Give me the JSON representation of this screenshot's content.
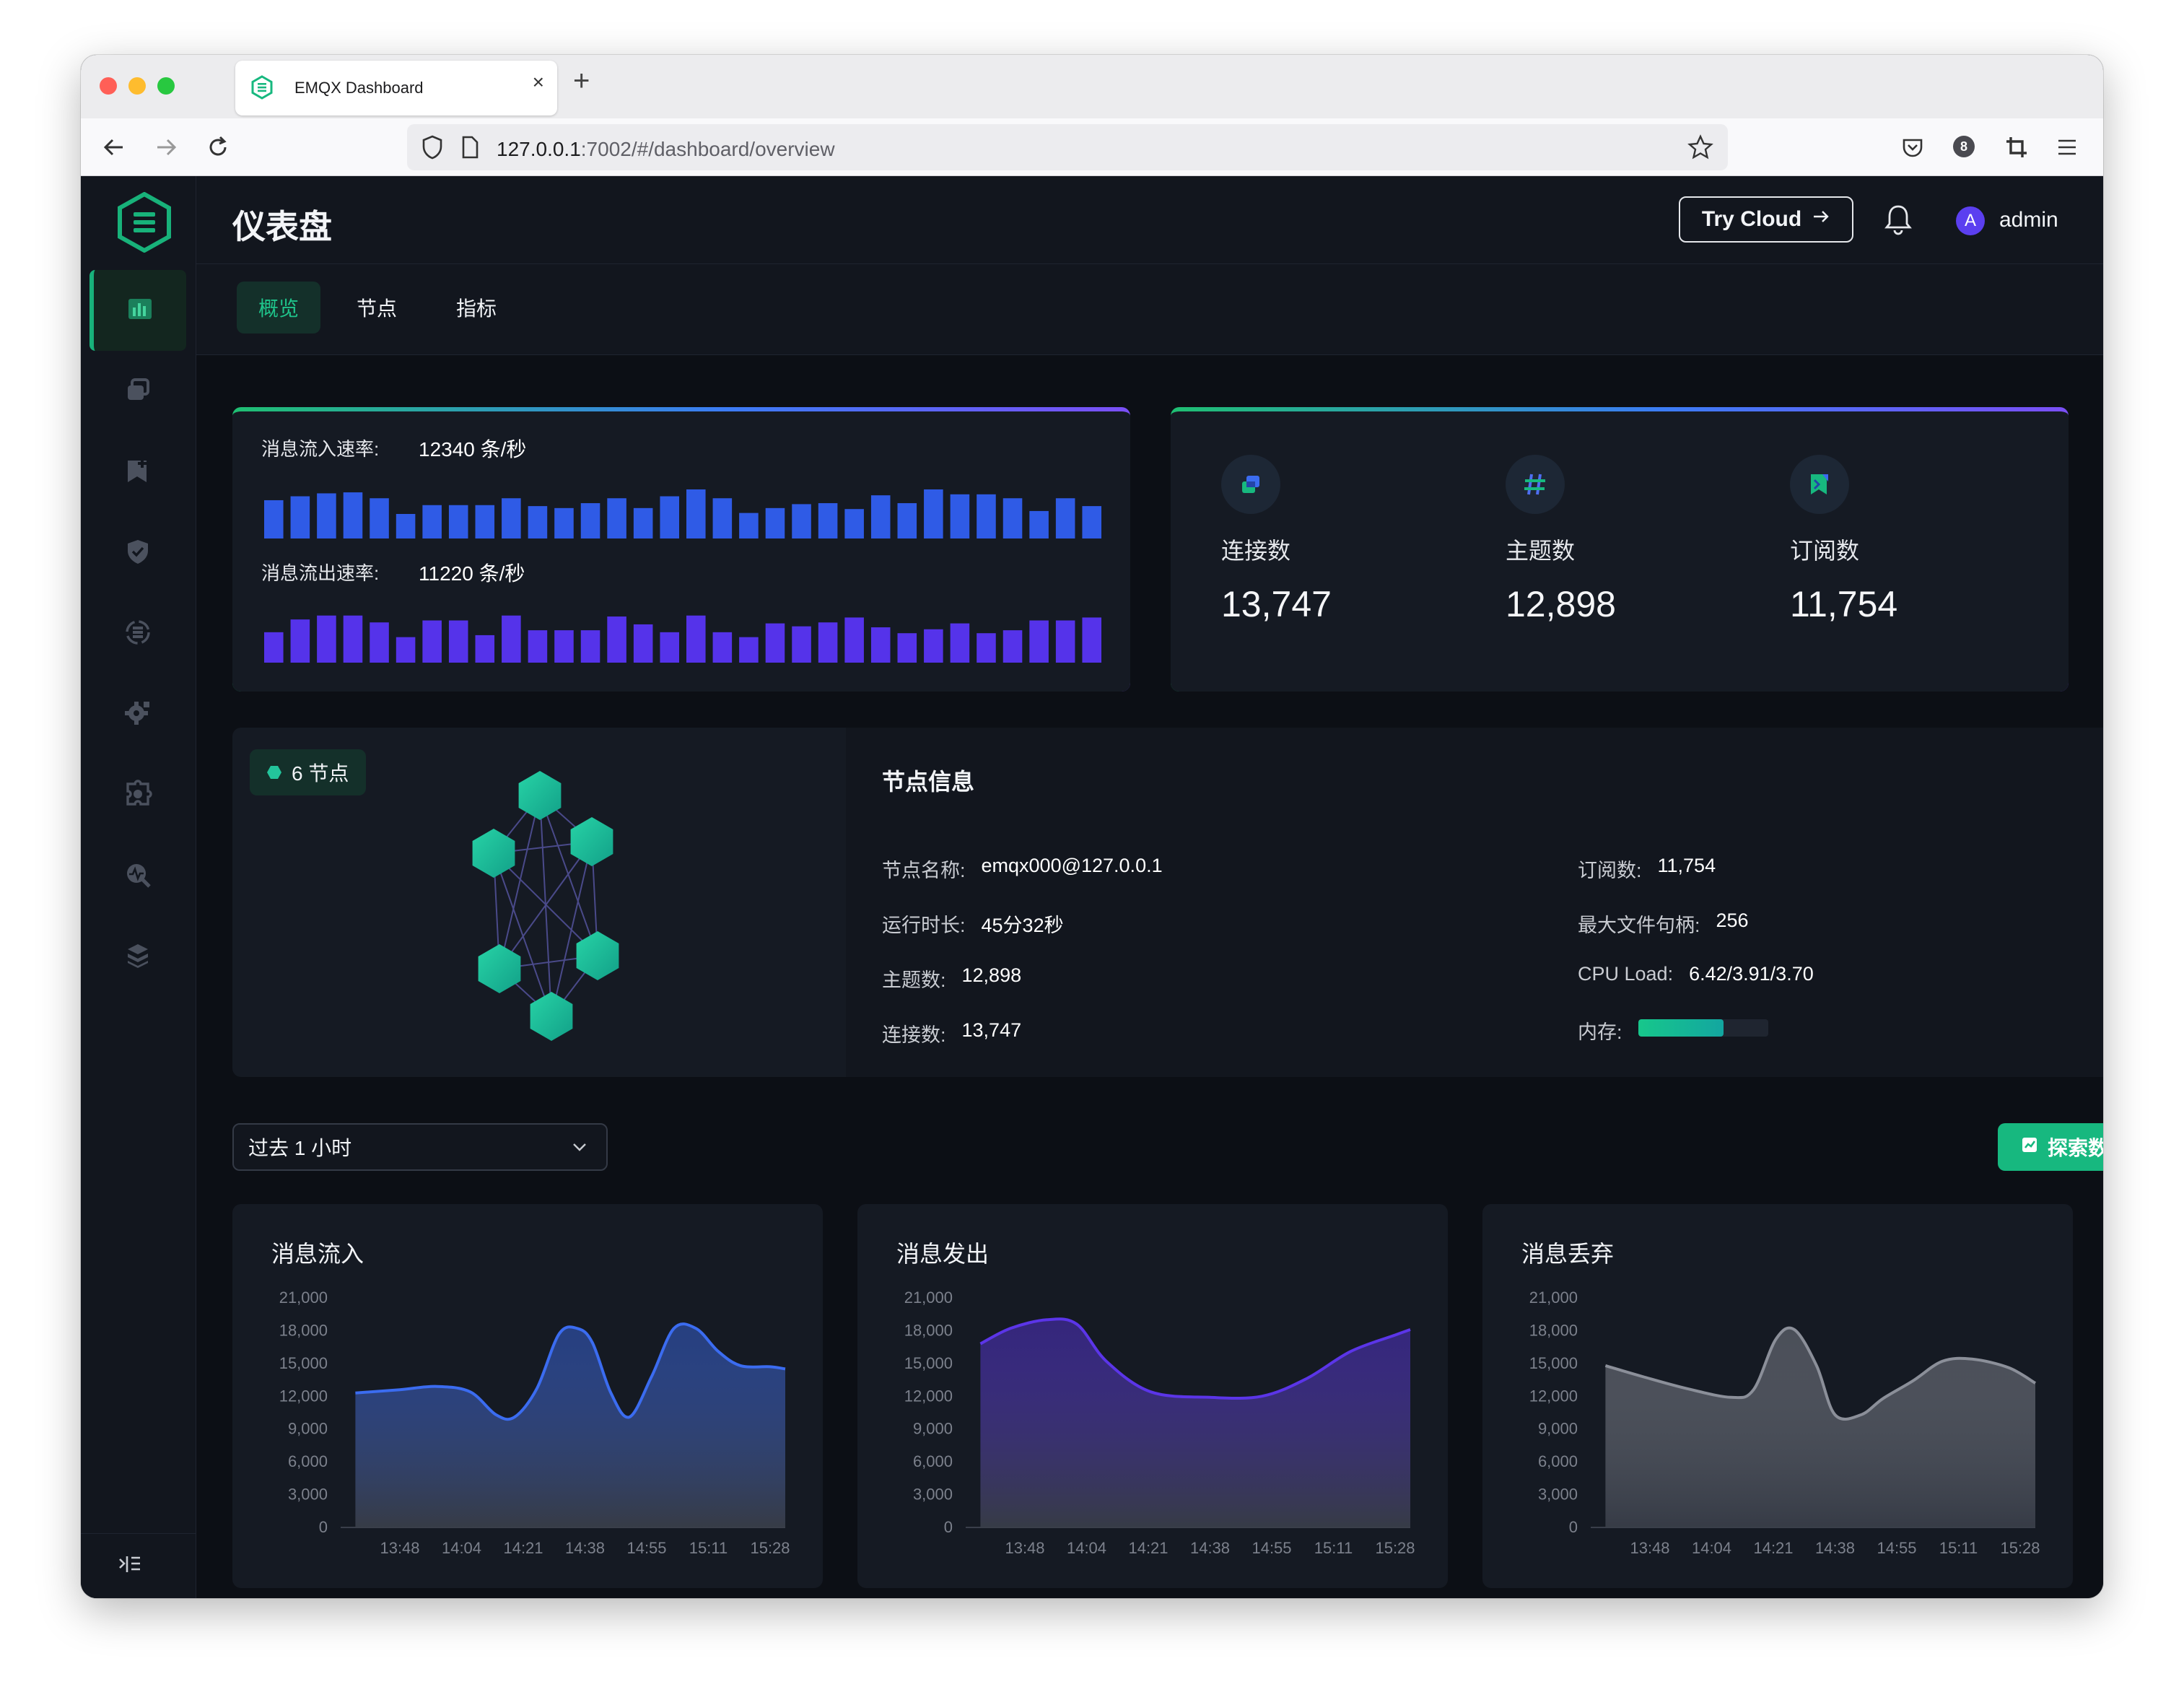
{
  "browser": {
    "tab_title": "EMQX Dashboard",
    "url_host": "127.0.0.1",
    "url_rest": ":7002/#/dashboard/overview",
    "extension_badge": "8",
    "traffic_lights": [
      "#ff5f57",
      "#febc2e",
      "#28c840"
    ]
  },
  "sidebar": {
    "logo_icon": "emqx-logo-icon",
    "items": [
      {
        "icon": "dashboard-icon",
        "active": true
      },
      {
        "icon": "connections-icon"
      },
      {
        "icon": "subscriptions-icon"
      },
      {
        "icon": "access-control-icon"
      },
      {
        "icon": "data-integration-icon"
      },
      {
        "icon": "management-icon"
      },
      {
        "icon": "extensions-icon"
      },
      {
        "icon": "diagnose-icon"
      },
      {
        "icon": "system-icon"
      }
    ],
    "collapse_icon": "collapse-sidebar-icon"
  },
  "header": {
    "title": "仪表盘",
    "try_cloud_label": "Try Cloud",
    "avatar_letter": "A",
    "username": "admin"
  },
  "subnav": {
    "tabs": [
      {
        "label": "概览",
        "active": true
      },
      {
        "label": "节点"
      },
      {
        "label": "指标"
      }
    ]
  },
  "rates": {
    "incoming_label": "消息流入速率:",
    "incoming_value": "12340 条/秒",
    "outgoing_label": "消息流出速率:",
    "outgoing_value": "11220 条/秒",
    "incoming_bars": [
      0.78,
      0.86,
      0.92,
      0.94,
      0.82,
      0.5,
      0.68,
      0.68,
      0.68,
      0.82,
      0.66,
      0.62,
      0.72,
      0.82,
      0.62,
      0.86,
      1.0,
      0.82,
      0.52,
      0.62,
      0.7,
      0.72,
      0.6,
      0.88,
      0.72,
      1.0,
      0.9,
      0.9,
      0.82,
      0.56,
      0.82,
      0.66
    ],
    "outgoing_bars": [
      0.62,
      0.88,
      0.96,
      0.96,
      0.82,
      0.52,
      0.86,
      0.86,
      0.56,
      0.96,
      0.66,
      0.66,
      0.66,
      0.94,
      0.78,
      0.62,
      0.96,
      0.62,
      0.52,
      0.8,
      0.74,
      0.82,
      0.92,
      0.72,
      0.6,
      0.68,
      0.8,
      0.6,
      0.66,
      0.86,
      0.86,
      0.92
    ],
    "incoming_color": "#2f5be6",
    "outgoing_color": "#5533ea"
  },
  "stats": [
    {
      "label": "连接数",
      "value": "13,747",
      "icon": "connections-stat-icon"
    },
    {
      "label": "主题数",
      "value": "12,898",
      "icon": "topics-hash-icon"
    },
    {
      "label": "订阅数",
      "value": "11,754",
      "icon": "subscriptions-stat-icon"
    }
  ],
  "cluster": {
    "badge": "6 节点"
  },
  "node_info": {
    "title": "节点信息",
    "left": [
      {
        "k": "节点名称:",
        "v": "emqx000@127.0.0.1"
      },
      {
        "k": "运行时长:",
        "v": "45分32秒"
      },
      {
        "k": "主题数:",
        "v": "12,898"
      },
      {
        "k": "连接数:",
        "v": "13,747"
      }
    ],
    "right": [
      {
        "k": "订阅数:",
        "v": "11,754"
      },
      {
        "k": "最大文件句柄:",
        "v": "256"
      },
      {
        "k": "CPU Load:",
        "v": "6.42/3.91/3.70"
      }
    ],
    "memory_label": "内存:",
    "memory_fraction": 0.66
  },
  "controls": {
    "range_label": "过去 1 小时",
    "explore_label": "探索数据"
  },
  "chart_data": [
    {
      "type": "area",
      "title": "消息流入",
      "x": [
        "13:48",
        "14:04",
        "14:21",
        "14:38",
        "14:55",
        "15:11",
        "15:28"
      ],
      "ylim": [
        0,
        21000
      ],
      "yticks": [
        "21,000",
        "18,000",
        "15,000",
        "12,000",
        "9,000",
        "6,000",
        "3,000",
        "0"
      ],
      "series": [
        {
          "values": [
            [
              -12,
              12300
            ],
            [
              0,
              12600
            ],
            [
              10,
              12900
            ],
            [
              19,
              12400
            ],
            [
              26,
              10300
            ],
            [
              31,
              10100
            ],
            [
              37,
              12700
            ],
            [
              43,
              17700
            ],
            [
              48,
              18200
            ],
            [
              52,
              16900
            ],
            [
              57,
              12300
            ],
            [
              62,
              10100
            ],
            [
              68,
              13800
            ],
            [
              74,
              18200
            ],
            [
              80,
              18200
            ],
            [
              86,
              16100
            ],
            [
              92,
              14800
            ],
            [
              100,
              14700
            ],
            [
              110,
              14500
            ]
          ]
        }
      ],
      "color": "#3b6cf0"
    },
    {
      "type": "area",
      "title": "消息发出",
      "x": [
        "13:48",
        "14:04",
        "14:21",
        "14:38",
        "14:55",
        "15:11",
        "15:28"
      ],
      "ylim": [
        0,
        21000
      ],
      "yticks": [
        "21,000",
        "18,000",
        "15,000",
        "12,000",
        "9,000",
        "6,000",
        "3,000",
        "0"
      ],
      "series": [
        {
          "values": [
            [
              -12,
              16800
            ],
            [
              -4,
              18200
            ],
            [
              6,
              19000
            ],
            [
              14,
              18600
            ],
            [
              22,
              15200
            ],
            [
              34,
              12400
            ],
            [
              50,
              11900
            ],
            [
              64,
              12000
            ],
            [
              76,
              13600
            ],
            [
              88,
              16100
            ],
            [
              100,
              17600
            ],
            [
              110,
              18100
            ]
          ]
        }
      ],
      "color": "#5b35e8"
    },
    {
      "type": "area",
      "title": "消息丢弃",
      "x": [
        "13:48",
        "14:04",
        "14:21",
        "14:38",
        "14:55",
        "15:11",
        "15:28"
      ],
      "ylim": [
        0,
        21000
      ],
      "yticks": [
        "21,000",
        "18,000",
        "15,000",
        "12,000",
        "9,000",
        "6,000",
        "3,000",
        "0"
      ],
      "series": [
        {
          "values": [
            [
              -12,
              14800
            ],
            [
              -2,
              13800
            ],
            [
              10,
              12700
            ],
            [
              22,
              11900
            ],
            [
              28,
              12600
            ],
            [
              34,
              17200
            ],
            [
              39,
              18100
            ],
            [
              45,
              14800
            ],
            [
              50,
              10300
            ],
            [
              57,
              10300
            ],
            [
              63,
              11800
            ],
            [
              71,
              13400
            ],
            [
              79,
              15200
            ],
            [
              87,
              15400
            ],
            [
              97,
              14600
            ],
            [
              105,
              13200
            ]
          ]
        }
      ],
      "color": "#8b8f99"
    }
  ]
}
